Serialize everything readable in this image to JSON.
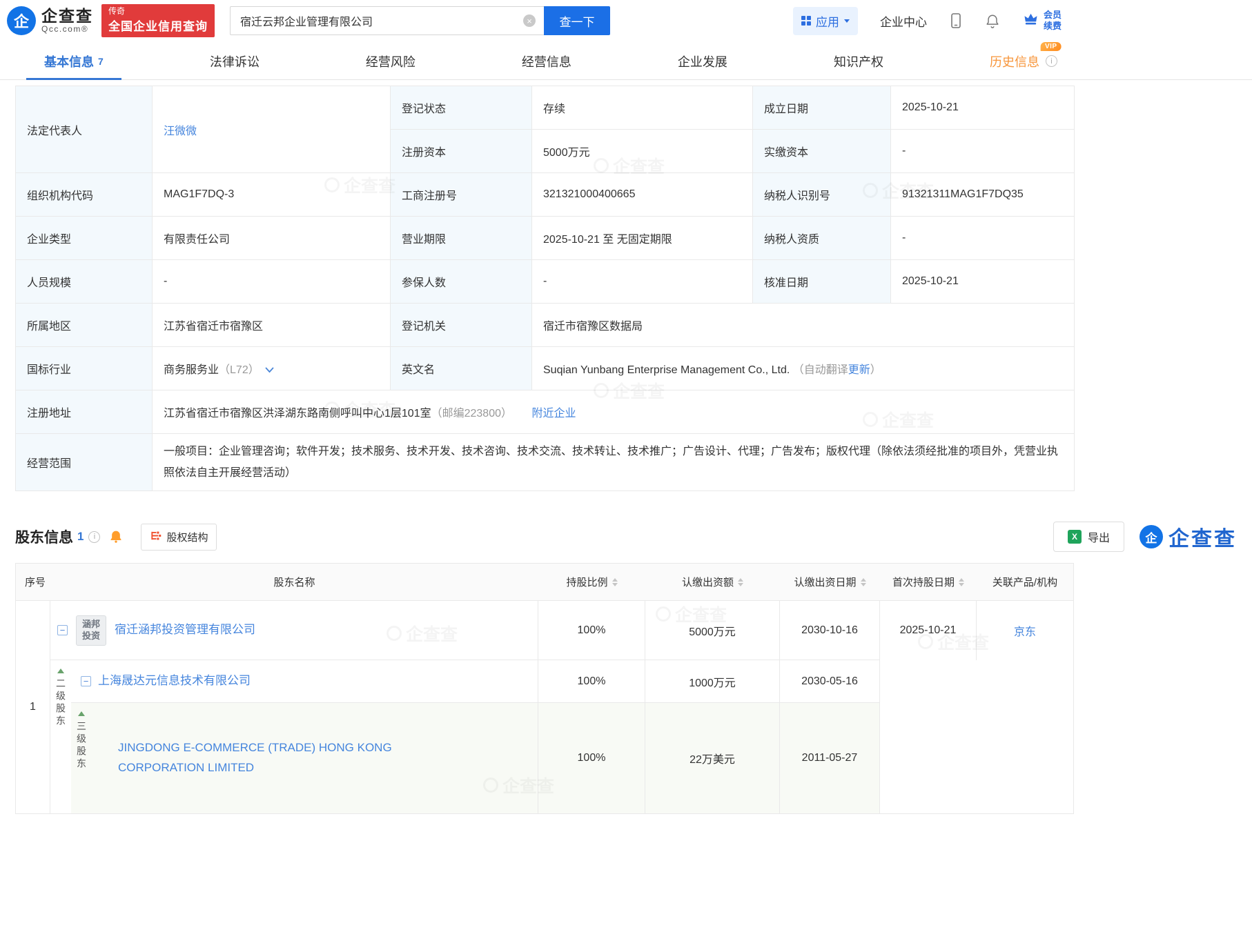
{
  "watermark": "企查查",
  "header": {
    "logo_char": "企",
    "logo_name": "企查查",
    "logo_domain": "Qcc.com®",
    "promo_tag": "传奇",
    "promo_text": "全国企业信用查询",
    "search_value": "宿迁云邦企业管理有限公司",
    "search_button": "查一下",
    "nav_apps": "应用",
    "nav_center": "企业中心",
    "member_line1": "会员",
    "member_line2": "续费"
  },
  "tabs": [
    {
      "label": "基本信息",
      "count": "7"
    },
    {
      "label": "法律诉讼"
    },
    {
      "label": "经营风险"
    },
    {
      "label": "经营信息"
    },
    {
      "label": "企业发展"
    },
    {
      "label": "知识产权"
    },
    {
      "label": "历史信息",
      "vip": "VIP"
    }
  ],
  "basic": {
    "legal_rep_label": "法定代表人",
    "legal_rep": "汪微微",
    "reg_status_label": "登记状态",
    "reg_status": "存续",
    "est_date_label": "成立日期",
    "est_date": "2025-10-21",
    "reg_capital_label": "注册资本",
    "reg_capital": "5000万元",
    "paid_capital_label": "实缴资本",
    "paid_capital": "-",
    "org_code_label": "组织机构代码",
    "org_code": "MAG1F7DQ-3",
    "biz_no_label": "工商注册号",
    "biz_no": "321321000400665",
    "tax_id_label": "纳税人识别号",
    "tax_id": "91321311MAG1F7DQ35",
    "type_label": "企业类型",
    "type": "有限责任公司",
    "term_label": "营业期限",
    "term": "2025-10-21 至 无固定期限",
    "tax_qual_label": "纳税人资质",
    "tax_qual": "-",
    "staff_label": "人员规模",
    "staff": "-",
    "insured_label": "参保人数",
    "insured": "-",
    "approve_label": "核准日期",
    "approve_date": "2025-10-21",
    "region_label": "所属地区",
    "region": "江苏省宿迁市宿豫区",
    "authority_label": "登记机关",
    "authority": "宿迁市宿豫区数据局",
    "industry_label": "国标行业",
    "industry": "商务服务业",
    "industry_code": "（L72）",
    "en_label": "英文名",
    "en_name": "Suqian Yunbang Enterprise Management Co., Ltd.",
    "en_note_prefix": "（自动翻译",
    "en_note_link": "更新",
    "en_note_suffix": "）",
    "addr_label": "注册地址",
    "addr": "江苏省宿迁市宿豫区洪泽湖东路南侧呼叫中心1层101室",
    "addr_zip": "（邮编223800）",
    "addr_nearby": "附近企业",
    "scope_label": "经营范围",
    "scope": "一般项目：企业管理咨询；软件开发；技术服务、技术开发、技术咨询、技术交流、技术转让、技术推广；广告设计、代理；广告发布；版权代理（除依法须经批准的项目外，凭营业执照依法自主开展经营活动）"
  },
  "sh": {
    "title": "股东信息",
    "count": "1",
    "equity_btn": "股权结构",
    "export_btn": "导出",
    "brand_char": "企",
    "brand_name": "企查查",
    "headers": [
      "序号",
      "股东名称",
      "持股比例",
      "认缴出资额",
      "认缴出资日期",
      "首次持股日期",
      "关联产品/机构"
    ],
    "r1": {
      "seq": "1",
      "logo1": "涵邦",
      "logo2": "投资",
      "name": "宿迁涵邦投资管理有限公司",
      "ratio": "100%",
      "amount": "5000万元",
      "sub_date": "2030-10-16",
      "first_date": "2025-10-21",
      "related": "京东"
    },
    "r2": {
      "level": "二级股东",
      "name": "上海晟达元信息技术有限公司",
      "ratio": "100%",
      "amount": "1000万元",
      "sub_date": "2030-05-16"
    },
    "r3": {
      "level": "三级股东",
      "name": "JINGDONG E-COMMERCE (TRADE) HONG KONG CORPORATION LIMITED",
      "ratio": "100%",
      "amount": "22万美元",
      "sub_date": "2011-05-27"
    }
  }
}
